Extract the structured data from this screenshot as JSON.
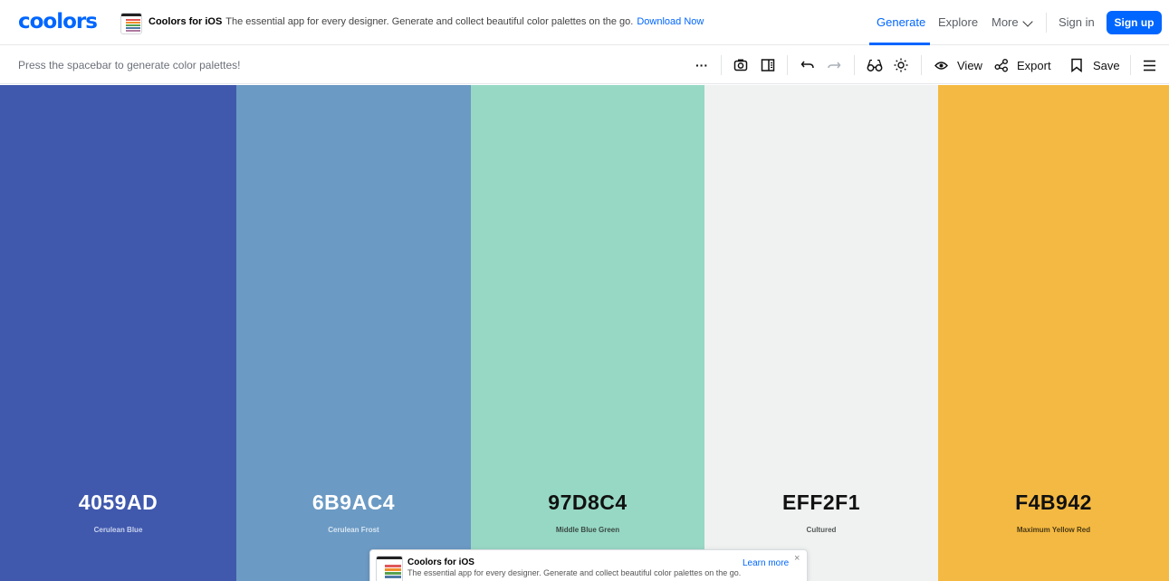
{
  "header": {
    "logo": "coolors",
    "promo": {
      "title": "Coolors for iOS",
      "text": "The essential app for every designer. Generate and collect beautiful color palettes on the go.",
      "link": "Download Now"
    },
    "nav": {
      "generate": "Generate",
      "explore": "Explore",
      "more": "More",
      "signin": "Sign in",
      "signup": "Sign up"
    }
  },
  "toolbar": {
    "hint": "Press the spacebar to generate color palettes!",
    "more_label": "···",
    "view": "View",
    "export": "Export",
    "save": "Save",
    "icons": [
      "more-icon",
      "camera-icon",
      "panel-icon",
      "undo-icon",
      "redo-icon",
      "glasses-icon",
      "sun-icon",
      "eye-icon",
      "share-icon",
      "bookmark-icon",
      "menu-icon"
    ]
  },
  "palette": [
    {
      "hex": "4059AD",
      "name": "Cerulean Blue",
      "color": "#4059AD",
      "text_color": "#ffffff",
      "name_color": "#c9d1ee"
    },
    {
      "hex": "6B9AC4",
      "name": "Cerulean Frost",
      "color": "#6B9AC4",
      "text_color": "#ffffff",
      "name_color": "#d9e6f2"
    },
    {
      "hex": "97D8C4",
      "name": "Middle Blue Green",
      "color": "#97D8C4",
      "text_color": "#111111",
      "name_color": "#3a4a44"
    },
    {
      "hex": "EFF2F1",
      "name": "Cultured",
      "color": "#EFF2F1",
      "text_color": "#111111",
      "name_color": "#555a58"
    },
    {
      "hex": "F4B942",
      "name": "Maximum Yellow Red",
      "color": "#F4B942",
      "text_color": "#111111",
      "name_color": "#4a3a14"
    }
  ],
  "popup": {
    "title": "Coolors for iOS",
    "text": "The essential app for every designer. Generate and collect beautiful color palettes on the go.",
    "link": "Learn more",
    "close": "×"
  },
  "brand_colors": {
    "accent": "#0066ff",
    "border": "#e6e8eb"
  }
}
